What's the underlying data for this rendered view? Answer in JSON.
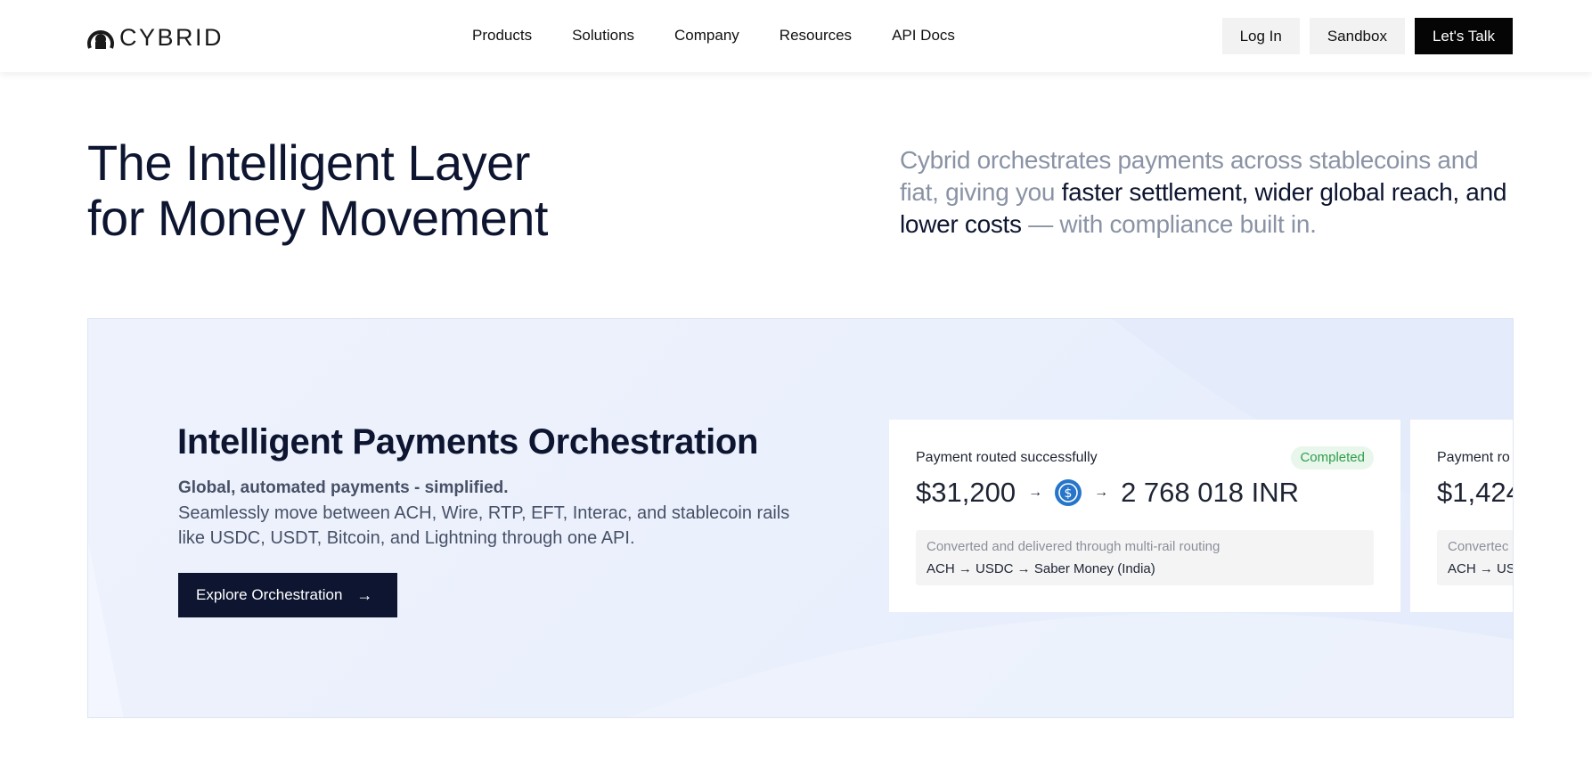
{
  "brand": {
    "name": "CYBRID"
  },
  "nav": {
    "items": [
      "Products",
      "Solutions",
      "Company",
      "Resources",
      "API Docs"
    ]
  },
  "header_actions": {
    "login": "Log In",
    "sandbox": "Sandbox",
    "talk": "Let's Talk"
  },
  "hero": {
    "title_line1": "The Intelligent Layer",
    "title_line2": "for Money Movement",
    "desc_part1": "Cybrid orchestrates payments across stablecoins and fiat, giving you ",
    "desc_highlight": "faster settlement, wider global reach, and lower costs",
    "desc_part2": " — with compliance built in."
  },
  "orchestration": {
    "title": "Intelligent Payments Orchestration",
    "subtitle": "Global, automated payments - simplified.",
    "body": "Seamlessly move between ACH, Wire, RTP, EFT, Interac, and stablecoin rails like USDC, USDT, Bitcoin, and Lightning through one API.",
    "cta": "Explore Orchestration",
    "cta_icon": "arrow-right-icon"
  },
  "cards": [
    {
      "label": "Payment routed successfully",
      "status": "Completed",
      "from_amount": "$31,200",
      "to_amount": "2 768 018 INR",
      "coin_icon": "usdc-coin-icon",
      "route_label": "Converted and delivered through multi-rail routing",
      "route_path": "ACH → USDC → Saber Money (India)"
    },
    {
      "label": "Payment ro",
      "from_amount": "$1,424",
      "route_label": "Convertec",
      "route_path": "ACH → US"
    }
  ],
  "colors": {
    "navy": "#0d1530",
    "muted": "#8a93a5",
    "panel_bg": "#eaf0fc",
    "badge_text": "#2f9e4a",
    "badge_bg": "#e9f6ec",
    "coin_blue": "#2775ca"
  }
}
